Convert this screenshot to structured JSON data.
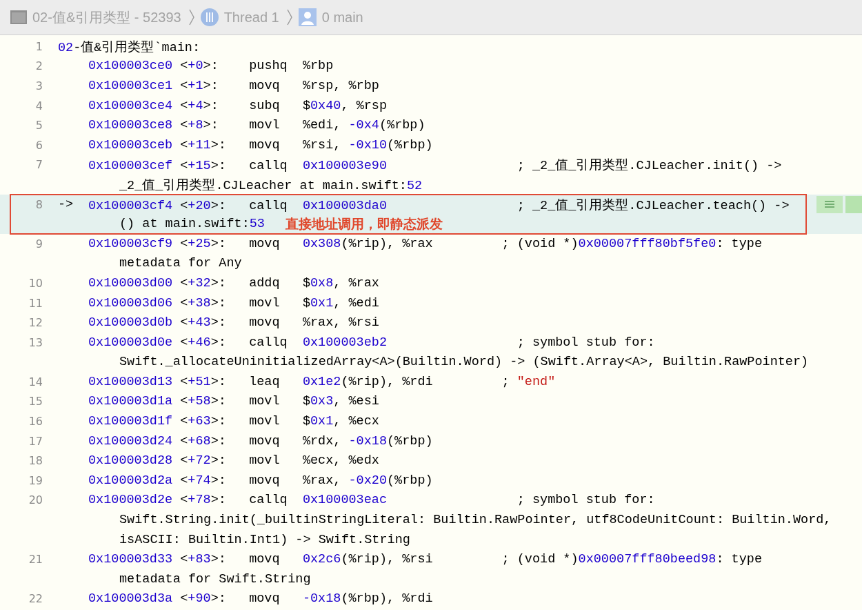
{
  "breadcrumb": [
    {
      "kind": "process",
      "label": "02-值&引用类型 - 52393"
    },
    {
      "kind": "thread",
      "label": "Thread 1"
    },
    {
      "kind": "frame",
      "label": "0 main"
    }
  ],
  "lines": [
    {
      "number": "1",
      "kind": "label",
      "current": false,
      "text": "02-值&引用类型`main:"
    },
    {
      "number": "2",
      "kind": "instruction",
      "current": false,
      "text": "0x100003ce0 <+0>:    pushq  %rbp"
    },
    {
      "number": "3",
      "kind": "instruction",
      "current": false,
      "text": "0x100003ce1 <+1>:    movq   %rsp, %rbp"
    },
    {
      "number": "4",
      "kind": "instruction",
      "current": false,
      "text": "0x100003ce4 <+4>:    subq   $0x40, %rsp"
    },
    {
      "number": "5",
      "kind": "instruction",
      "current": false,
      "text": "0x100003ce8 <+8>:    movl   %edi, -0x4(%rbp)"
    },
    {
      "number": "6",
      "kind": "instruction",
      "current": false,
      "text": "0x100003ceb <+11>:   movq   %rsi, -0x10(%rbp)"
    },
    {
      "number": "7",
      "kind": "instruction",
      "current": false,
      "text": "0x100003cef <+15>:   callq  0x100003e90                 ; _2_值_引用类型.CJLeacher.init() ->",
      "continuation": [
        "_2_值_引用类型.CJLeacher at main.swift:52"
      ]
    },
    {
      "number": "8",
      "kind": "instruction",
      "current": true,
      "marker": "->",
      "text": "0x100003cf4 <+20>:   callq  0x100003da0                 ; _2_值_引用类型.CJLeacher.teach() ->",
      "continuation": [
        "() at main.swift:53"
      ],
      "annotation": "直接地址调用，即静态派发"
    },
    {
      "number": "9",
      "kind": "instruction",
      "current": false,
      "text": "0x100003cf9 <+25>:   movq   0x308(%rip), %rax         ; (void *)0x00007fff80bf5fe0: type",
      "continuation": [
        "metadata for Any"
      ]
    },
    {
      "number": "10",
      "kind": "instruction",
      "current": false,
      "text": "0x100003d00 <+32>:   addq   $0x8, %rax"
    },
    {
      "number": "11",
      "kind": "instruction",
      "current": false,
      "text": "0x100003d06 <+38>:   movl   $0x1, %edi"
    },
    {
      "number": "12",
      "kind": "instruction",
      "current": false,
      "text": "0x100003d0b <+43>:   movq   %rax, %rsi"
    },
    {
      "number": "13",
      "kind": "instruction",
      "current": false,
      "text": "0x100003d0e <+46>:   callq  0x100003eb2                 ; symbol stub for:",
      "continuation": [
        "Swift._allocateUninitializedArray<A>(Builtin.Word) -> (Swift.Array<A>, Builtin.RawPointer)"
      ]
    },
    {
      "number": "14",
      "kind": "instruction",
      "current": false,
      "text": "0x100003d13 <+51>:   leaq   0x1e2(%rip), %rdi         ; \"end\""
    },
    {
      "number": "15",
      "kind": "instruction",
      "current": false,
      "text": "0x100003d1a <+58>:   movl   $0x3, %esi"
    },
    {
      "number": "16",
      "kind": "instruction",
      "current": false,
      "text": "0x100003d1f <+63>:   movl   $0x1, %ecx"
    },
    {
      "number": "17",
      "kind": "instruction",
      "current": false,
      "text": "0x100003d24 <+68>:   movq   %rdx, -0x18(%rbp)"
    },
    {
      "number": "18",
      "kind": "instruction",
      "current": false,
      "text": "0x100003d28 <+72>:   movl   %ecx, %edx"
    },
    {
      "number": "19",
      "kind": "instruction",
      "current": false,
      "text": "0x100003d2a <+74>:   movq   %rax, -0x20(%rbp)"
    },
    {
      "number": "20",
      "kind": "instruction",
      "current": false,
      "text": "0x100003d2e <+78>:   callq  0x100003eac                 ; symbol stub for:",
      "continuation": [
        "Swift.String.init(_builtinStringLiteral: Builtin.RawPointer, utf8CodeUnitCount: Builtin.Word,",
        "isASCII: Builtin.Int1) -> Swift.String"
      ]
    },
    {
      "number": "21",
      "kind": "instruction",
      "current": false,
      "text": "0x100003d33 <+83>:   movq   0x2c6(%rip), %rsi         ; (void *)0x00007fff80beed98: type",
      "continuation": [
        "metadata for Swift.String"
      ]
    },
    {
      "number": "22",
      "kind": "instruction",
      "current": false,
      "text": "0x100003d3a <+90>:   movq   -0x18(%rbp), %rdi"
    }
  ]
}
